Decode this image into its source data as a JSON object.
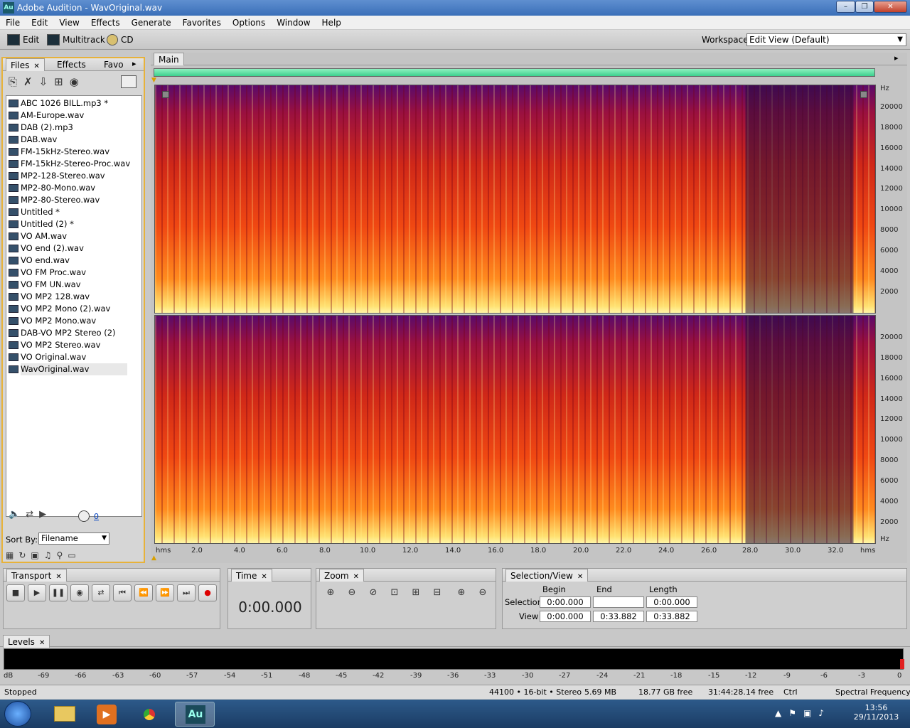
{
  "window": {
    "title": "Adobe Audition - WavOriginal.wav",
    "app_icon": "Au",
    "controls": [
      "–",
      "❐",
      "✕"
    ]
  },
  "menu": [
    "File",
    "Edit",
    "View",
    "Effects",
    "Generate",
    "Favorites",
    "Options",
    "Window",
    "Help"
  ],
  "toolbar": {
    "edit_label": "Edit",
    "multitrack_label": "Multitrack",
    "cd_label": "CD",
    "workspace_label": "Workspace:",
    "workspace_value": "Edit View (Default)"
  },
  "files_panel": {
    "tabs": [
      "Files",
      "Effects",
      "Favo"
    ],
    "files": [
      "ABC 1026 BILL.mp3 *",
      "AM-Europe.wav",
      "DAB (2).mp3",
      "DAB.wav",
      "FM-15kHz-Stereo.wav",
      "FM-15kHz-Stereo-Proc.wav",
      "MP2-128-Stereo.wav",
      "MP2-80-Mono.wav",
      "MP2-80-Stereo.wav",
      "Untitled *",
      "Untitled (2) *",
      "VO AM.wav",
      "VO end (2).wav",
      "VO end.wav",
      "VO FM Proc.wav",
      "VO FM UN.wav",
      "VO MP2 128.wav",
      "VO MP2 Mono (2).wav",
      "VO MP2 Mono.wav",
      "DAB-VO MP2 Stereo (2)",
      "VO MP2 Stereo.wav",
      "VO Original.wav",
      "WavOriginal.wav"
    ],
    "selected": "WavOriginal.wav",
    "sort_label": "Sort By:",
    "sort_value": "Filename",
    "volume_value": "0"
  },
  "main": {
    "tab": "Main",
    "hz_unit": "Hz",
    "time_unit": "hms",
    "hz_ticks": [
      "20000",
      "18000",
      "16000",
      "14000",
      "12000",
      "10000",
      "8000",
      "6000",
      "4000",
      "2000"
    ],
    "time_ticks": [
      "2.0",
      "4.0",
      "6.0",
      "8.0",
      "10.0",
      "12.0",
      "14.0",
      "16.0",
      "18.0",
      "20.0",
      "22.0",
      "24.0",
      "26.0",
      "28.0",
      "30.0",
      "32.0"
    ]
  },
  "transport": {
    "tab": "Transport"
  },
  "time": {
    "tab": "Time",
    "value": "0:00.000"
  },
  "zoom": {
    "tab": "Zoom"
  },
  "selection_view": {
    "tab": "Selection/View",
    "begin_label": "Begin",
    "end_label": "End",
    "length_label": "Length",
    "selection_label": "Selection",
    "view_label": "View",
    "selection_begin": "0:00.000",
    "selection_end": "",
    "selection_length": "0:00.000",
    "view_begin": "0:00.000",
    "view_end": "0:33.882",
    "view_length": "0:33.882"
  },
  "levels": {
    "tab": "Levels",
    "db_label": "dB",
    "ticks": [
      "-69",
      "-66",
      "-63",
      "-60",
      "-57",
      "-54",
      "-51",
      "-48",
      "-45",
      "-42",
      "-39",
      "-36",
      "-33",
      "-30",
      "-27",
      "-24",
      "-21",
      "-18",
      "-15",
      "-12",
      "-9",
      "-6",
      "-3",
      "0"
    ]
  },
  "status": {
    "state": "Stopped",
    "format": "44100 • 16-bit • Stereo",
    "size": "5.69 MB",
    "free": "18.77 GB free",
    "time_free": "31:44:28.14 free",
    "modifier": "Ctrl",
    "view_mode": "Spectral Frequency"
  },
  "taskbar": {
    "time": "13:56",
    "date": "29/11/2013",
    "active_app": "Au"
  }
}
